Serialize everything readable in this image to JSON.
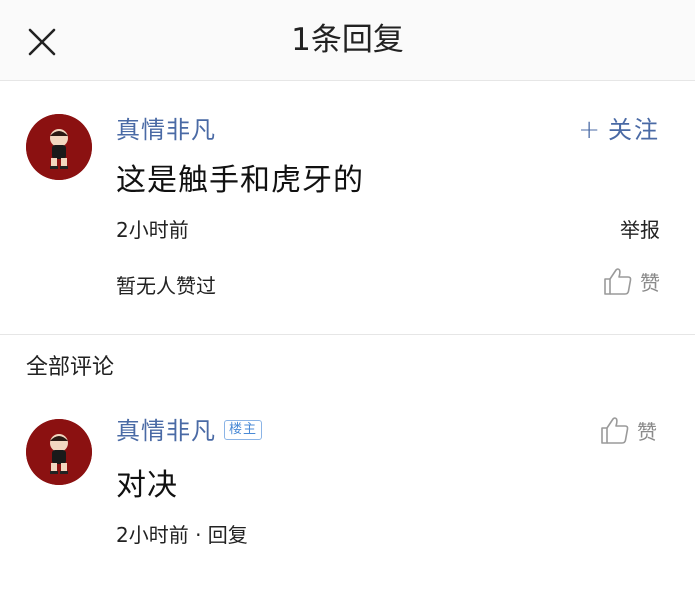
{
  "header": {
    "title": "1条回复",
    "close_icon": "close-icon"
  },
  "main_comment": {
    "username": "真情非凡",
    "follow_label": "关注",
    "content": "这是触手和虎牙的",
    "time": "2小时前",
    "report_label": "举报",
    "likes_text": "暂无人赞过",
    "like_label": "赞"
  },
  "comments_section": {
    "title": "全部评论",
    "items": [
      {
        "username": "真情非凡",
        "badge": "楼主",
        "content": "对决",
        "meta": "2小时前 · 回复",
        "like_label": "赞"
      }
    ]
  },
  "colors": {
    "username": "#4a6aa5",
    "badge": "#4a8ad6",
    "avatar_bg": "#8b1111"
  }
}
